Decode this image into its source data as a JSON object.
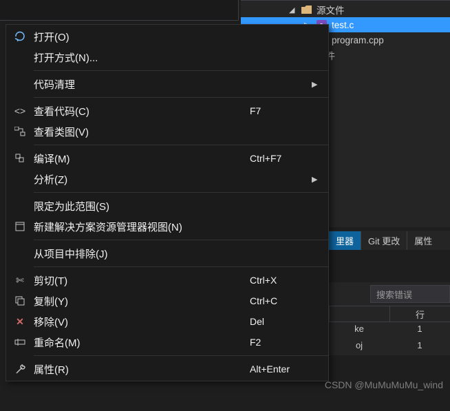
{
  "tree": {
    "parent_label": "源文件",
    "selected_file": "test.c",
    "other_file": "program.cpp",
    "truncated_folder": "文件"
  },
  "tabs": {
    "active_partial": "里器",
    "git": "Git 更改",
    "props": "属性"
  },
  "errorPanel": {
    "search_placeholder": "搜索错误",
    "col_line": "行",
    "rows": [
      {
        "ext": "ke",
        "line": "1"
      },
      {
        "ext": "oj",
        "line": "1"
      }
    ]
  },
  "menu": {
    "open": "打开(O)",
    "open_with": "打开方式(N)...",
    "code_clean": "代码清理",
    "view_code": "查看代码(C)",
    "view_code_k": "F7",
    "view_class": "查看类图(V)",
    "compile": "编译(M)",
    "compile_k": "Ctrl+F7",
    "analyze": "分析(Z)",
    "scope": "限定为此范围(S)",
    "new_view": "新建解决方案资源管理器视图(N)",
    "exclude": "从项目中排除(J)",
    "cut": "剪切(T)",
    "cut_k": "Ctrl+X",
    "copy": "复制(Y)",
    "copy_k": "Ctrl+C",
    "delete": "移除(V)",
    "delete_k": "Del",
    "rename": "重命名(M)",
    "rename_k": "F2",
    "props": "属性(R)",
    "props_k": "Alt+Enter"
  },
  "watermark": "CSDN @MuMuMuMu_wind"
}
